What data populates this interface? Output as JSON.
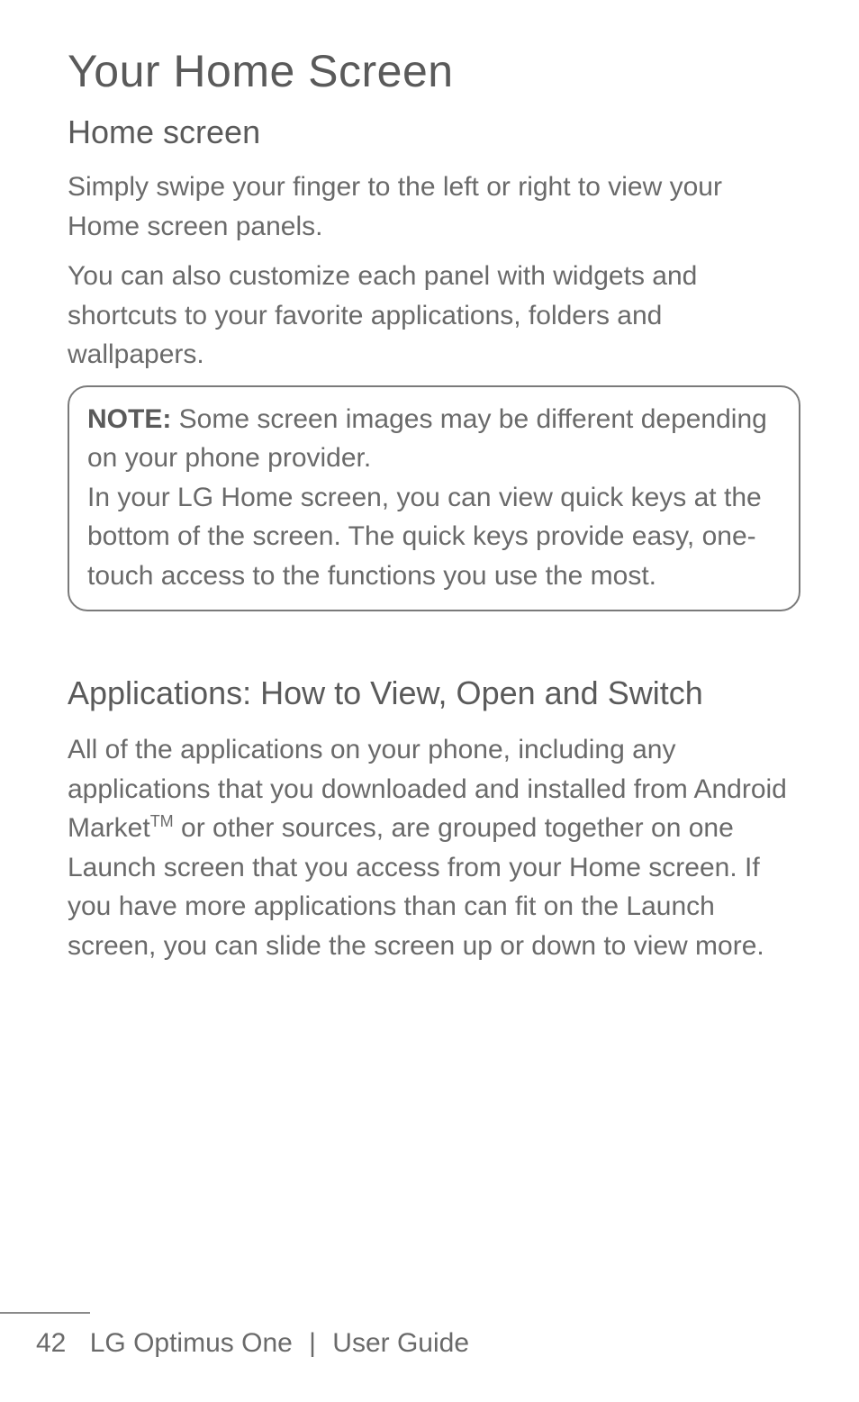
{
  "title": "Your Home Screen",
  "section1": {
    "heading": "Home screen",
    "para1": "Simply swipe your finger to the left or right to view your Home screen panels.",
    "para2": "You can also customize each panel with widgets and shortcuts to your favorite applications, folders and wallpapers."
  },
  "note": {
    "label": "NOTE:",
    "text1": " Some screen images may be different depending on your phone provider.",
    "text2": "In your LG Home screen, you can view quick keys at the bottom of the screen. The quick keys provide easy, one-touch access to the functions you use the most."
  },
  "section2": {
    "heading": "Applications: How to View, Open and Switch",
    "para_a": "All of the applications on your phone, including any applications that you downloaded and installed from Android Market",
    "tm": "TM",
    "para_b": " or other sources, are grouped together on one Launch screen that you access from your Home screen. If you have more applications than can fit on the Launch screen, you can slide the screen up or down to view more."
  },
  "footer": {
    "page": "42",
    "product": "LG Optimus One",
    "sep": "|",
    "doc": "User Guide"
  }
}
